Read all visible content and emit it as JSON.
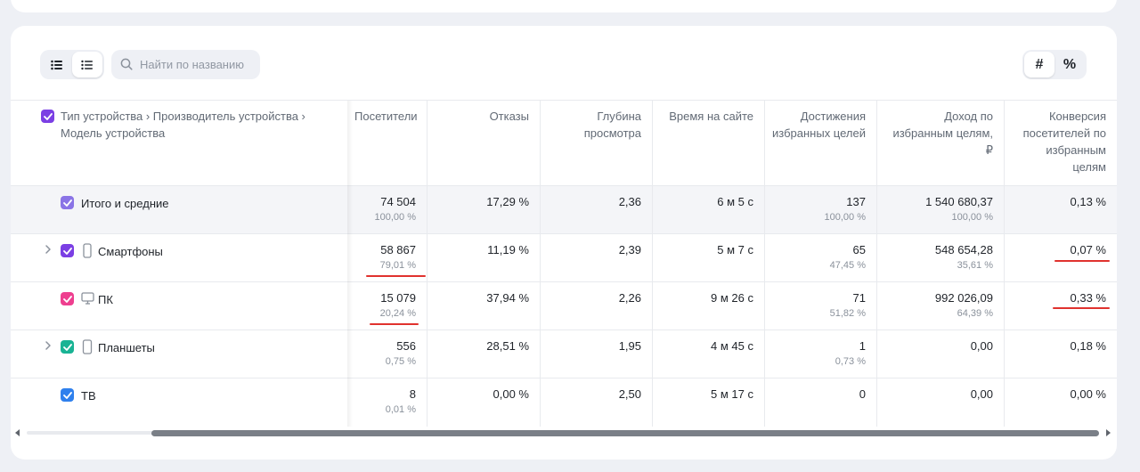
{
  "toolbar": {
    "search_placeholder": "Найти по названию",
    "mode_count_label": "#",
    "mode_percent_label": "%"
  },
  "table": {
    "dimension_header": "Тип устройства › Производитель устройства › Модель устройства",
    "columns": [
      "Посетители",
      "Отказы",
      "Глубина просмотра",
      "Время на сайте",
      "Достижения избранных целей",
      "Доход по избранным целям, ₽",
      "Конверсия посетителей по избранным целям"
    ],
    "total": {
      "label": "Итого и средние",
      "visitors": "74 504",
      "visitors_pct": "100,00 %",
      "bounces": "17,29 %",
      "depth": "2,36",
      "time": "6 м 5 с",
      "goals": "137",
      "goals_pct": "100,00 %",
      "revenue": "1 540 680,37",
      "revenue_pct": "100,00 %",
      "conversion": "0,13 %"
    },
    "rows": [
      {
        "label": "Смартфоны",
        "expandable": true,
        "checkbox_color": "#7b3fe4",
        "icon": "smartphone-icon",
        "visitors": "58 867",
        "visitors_pct": "79,01 %",
        "bounces": "11,19 %",
        "depth": "2,39",
        "time": "5 м 7 с",
        "goals": "65",
        "goals_pct": "47,45 %",
        "revenue": "548 654,28",
        "revenue_pct": "35,61 %",
        "conversion": "0,07 %"
      },
      {
        "label": "ПК",
        "expandable": false,
        "checkbox_color": "#ee3f8f",
        "icon": "desktop-icon",
        "visitors": "15 079",
        "visitors_pct": "20,24 %",
        "bounces": "37,94 %",
        "depth": "2,26",
        "time": "9 м 26 с",
        "goals": "71",
        "goals_pct": "51,82 %",
        "revenue": "992 026,09",
        "revenue_pct": "64,39 %",
        "conversion": "0,33 %"
      },
      {
        "label": "Планшеты",
        "expandable": true,
        "checkbox_color": "#19b394",
        "icon": "tablet-icon",
        "visitors": "556",
        "visitors_pct": "0,75 %",
        "bounces": "28,51 %",
        "depth": "1,95",
        "time": "4 м 45 с",
        "goals": "1",
        "goals_pct": "0,73 %",
        "revenue": "0,00",
        "revenue_pct": "",
        "conversion": "0,18 %"
      },
      {
        "label": "ТВ",
        "expandable": false,
        "checkbox_color": "#2f80ed",
        "icon": "",
        "visitors": "8",
        "visitors_pct": "0,01 %",
        "bounces": "0,00 %",
        "depth": "2,50",
        "time": "5 м 17 с",
        "goals": "0",
        "goals_pct": "",
        "revenue": "0,00",
        "revenue_pct": "",
        "conversion": "0,00 %"
      }
    ]
  },
  "colors": {
    "header_checkbox": "#7b3fe4",
    "total_checkbox": "#8a74e6",
    "annotation_underline": "#e0322e"
  }
}
